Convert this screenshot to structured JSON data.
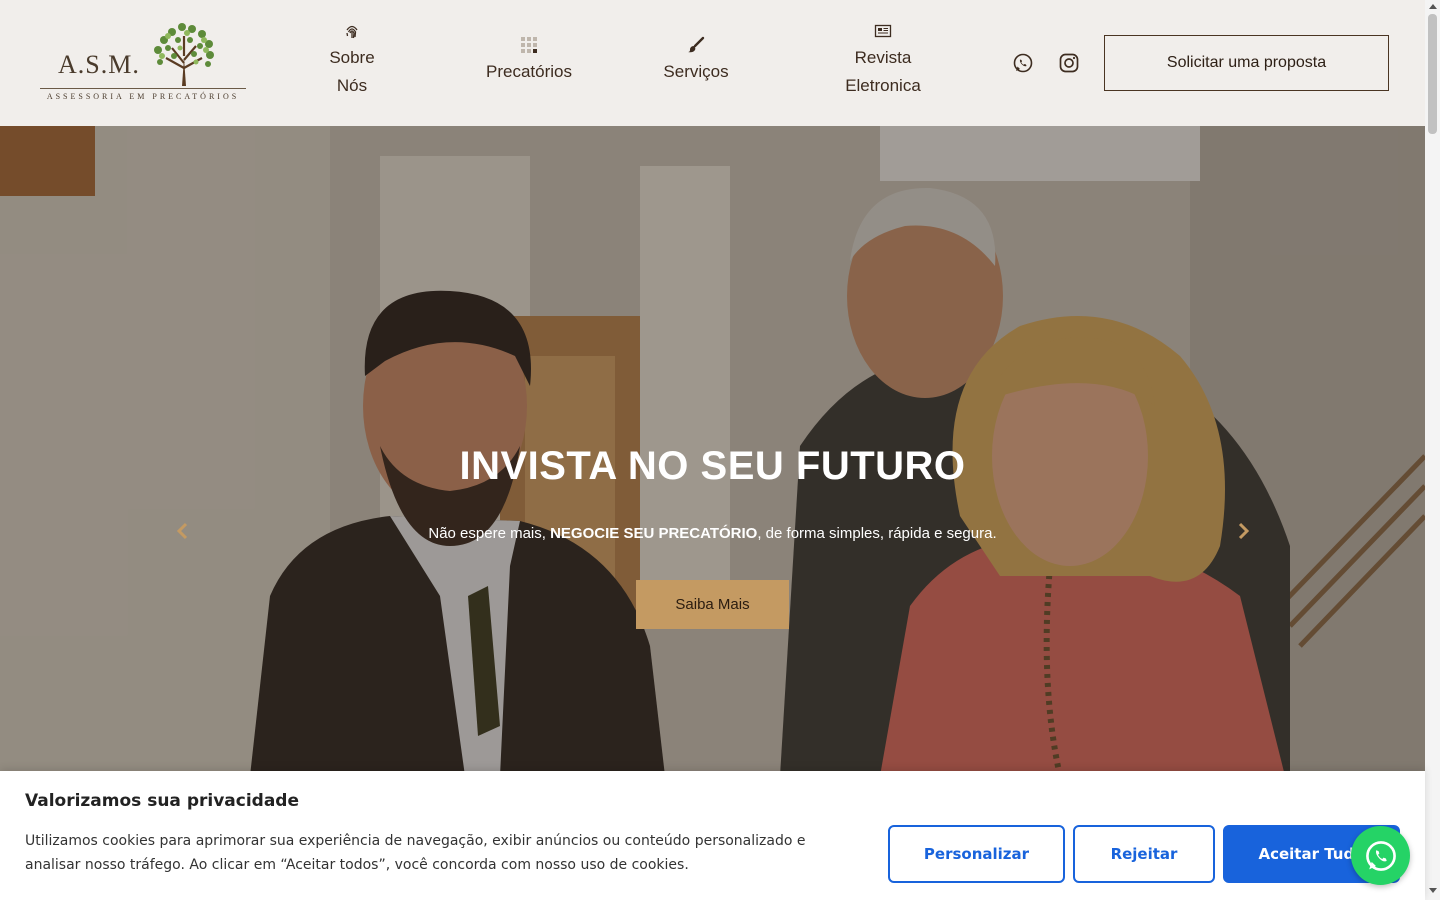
{
  "header": {
    "logo_text": "A.S.M.",
    "logo_subtitle": "ASSESSORIA EM PRECATÓRIOS",
    "nav": [
      {
        "line1": "Sobre",
        "line2": "Nós",
        "icon": "fingerprint-icon"
      },
      {
        "line1": "Precatórios",
        "line2": "",
        "icon": "grid-icon"
      },
      {
        "line1": "Serviços",
        "line2": "",
        "icon": "brush-icon"
      },
      {
        "line1": "Revista",
        "line2": "Eletronica",
        "icon": "newspaper-icon"
      }
    ],
    "social": [
      "whatsapp-icon",
      "instagram-icon"
    ],
    "cta_label": "Solicitar uma proposta"
  },
  "hero": {
    "title": "INVISTA NO SEU FUTURO",
    "subtitle_pre": "Não espere mais, ",
    "subtitle_bold": "NEGOCIE SEU PRECATÓRIO",
    "subtitle_post": ", de forma simples, rápida e segura.",
    "button_label": "Saiba Mais",
    "accent_color": "#c49a62"
  },
  "cookie": {
    "title": "Valorizamos sua privacidade",
    "text": "Utilizamos cookies para aprimorar sua experiência de navegação, exibir anúncios ou conteúdo personalizado e analisar nosso tráfego. Ao clicar em “Aceitar todos”, você concorda com nosso uso de cookies.",
    "customize_label": "Personalizar",
    "reject_label": "Rejeitar",
    "accept_label": "Aceitar Tudo",
    "button_color": "#1863dc"
  },
  "whatsapp_float": "whatsapp-icon"
}
